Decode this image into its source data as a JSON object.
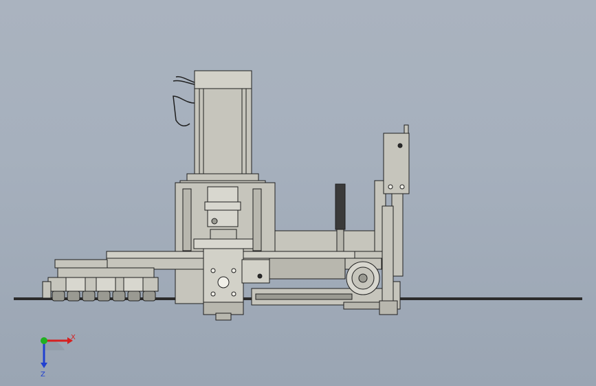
{
  "viewport": {
    "background_top": "#aab3bf",
    "background_bottom": "#9aa5b3"
  },
  "model": {
    "part_fill": "#c6c5bc",
    "part_dark": "#9a9a92",
    "edge_color": "#1e1e1e",
    "rail_color": "#2b2b2b"
  },
  "triad": {
    "x_label": "X",
    "z_label": "Z",
    "x_color": "#d62020",
    "y_color": "#20b020",
    "z_color": "#2040d0"
  }
}
